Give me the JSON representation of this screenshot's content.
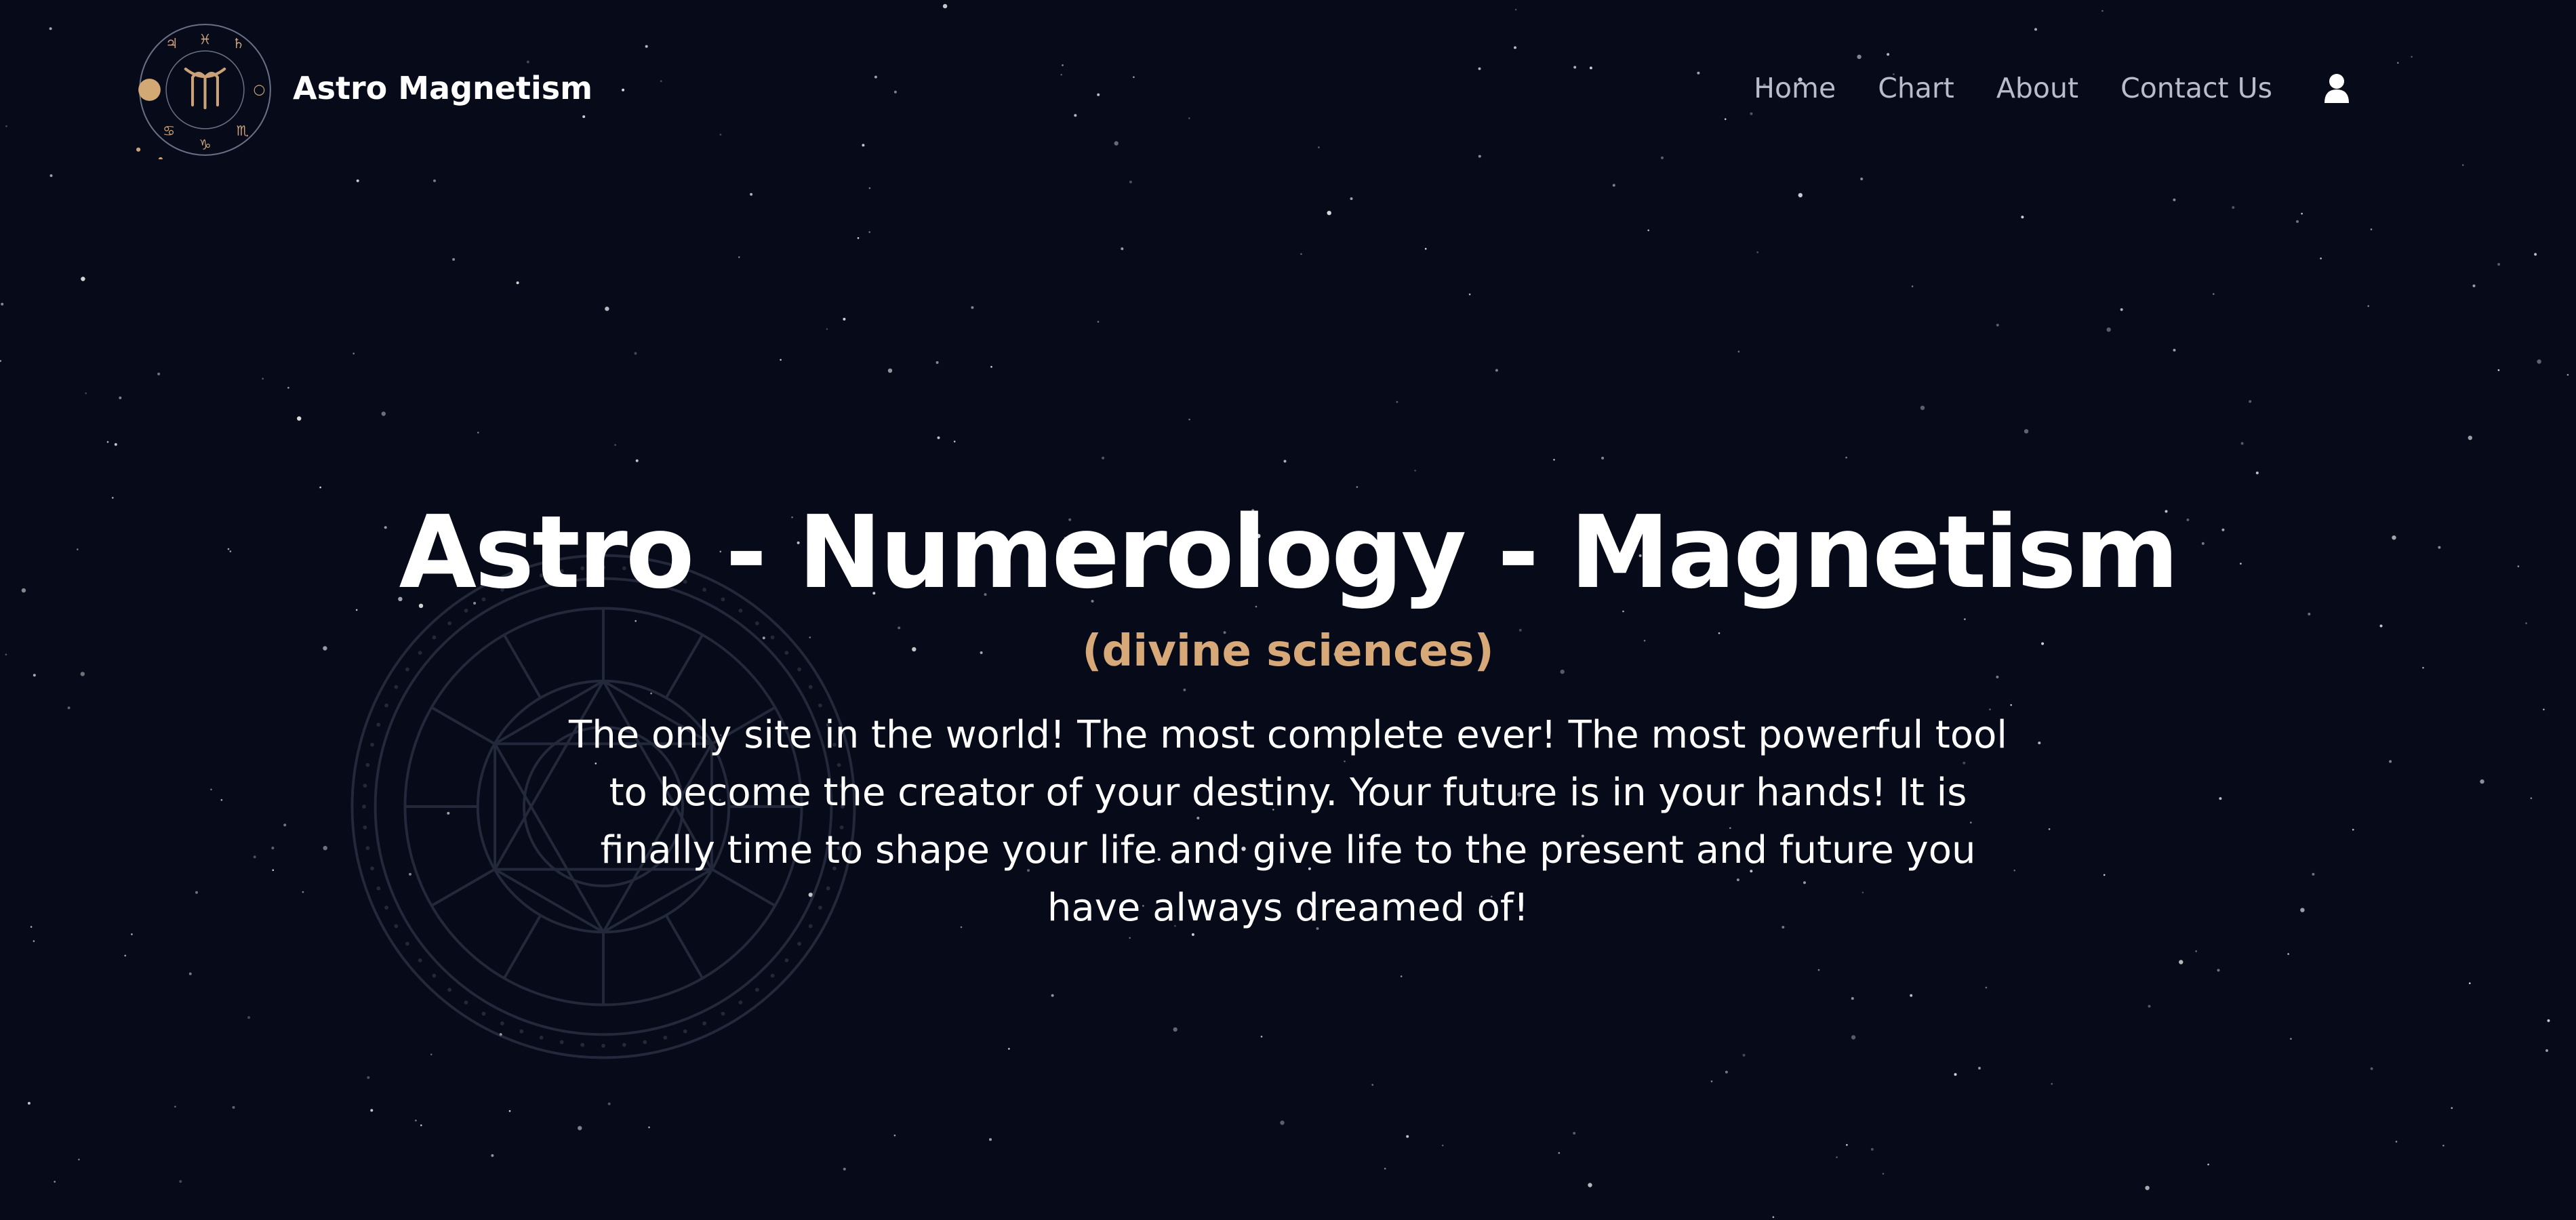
{
  "brand": {
    "name": "Astro Magnetism",
    "logo_icon": "zodiac-wheel-logo-icon",
    "accent_color": "#c9a27a"
  },
  "nav": {
    "items": [
      {
        "label": "Home"
      },
      {
        "label": "Chart"
      },
      {
        "label": "About"
      },
      {
        "label": "Contact Us"
      }
    ],
    "user_icon": "user-icon"
  },
  "hero": {
    "title": "Astro - Numerology - Magnetism",
    "subtitle": "(divine sciences)",
    "description": "The only site in the world! The most complete ever! The most powerful tool to become the creator of your destiny. Your future is in your hands! It is finally time to shape your life and give life to the present and future you have always dreamed of!",
    "background_icon": "astrology-chart-wheel-icon"
  },
  "colors": {
    "background": "#070a18",
    "title": "#ffffff",
    "subtitle": "#d7a878",
    "nav_text": "#b9bccb"
  }
}
